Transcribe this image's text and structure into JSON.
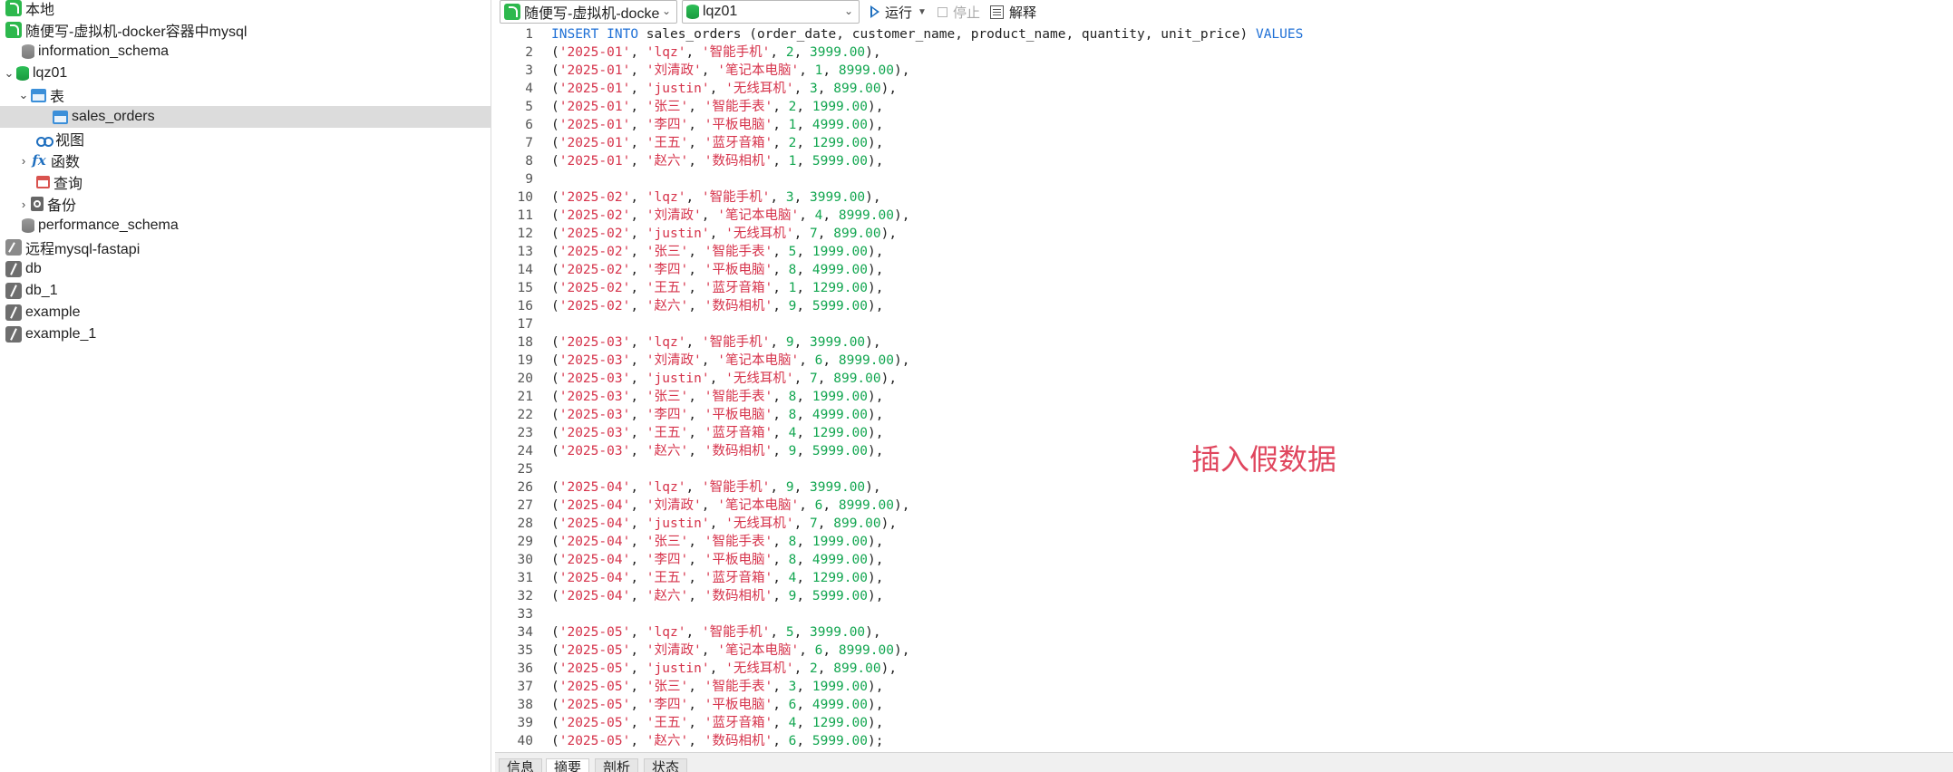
{
  "sidebar": {
    "items": [
      {
        "label": "本地",
        "icon": "connection-green-icon"
      },
      {
        "label": "随便写-虚拟机-docker容器中mysql",
        "icon": "connection-green-icon"
      },
      {
        "label": "information_schema",
        "icon": "database-icon"
      },
      {
        "label": "lqz01",
        "icon": "database-open-icon"
      },
      {
        "label": "表",
        "icon": "table-folder-icon"
      },
      {
        "label": "sales_orders",
        "icon": "table-icon"
      },
      {
        "label": "视图",
        "icon": "view-icon"
      },
      {
        "label": "函数",
        "icon": "function-icon"
      },
      {
        "label": "查询",
        "icon": "query-icon"
      },
      {
        "label": "备份",
        "icon": "backup-icon"
      },
      {
        "label": "performance_schema",
        "icon": "database-icon"
      },
      {
        "label": "远程mysql-fastapi",
        "icon": "connection-gray-icon"
      },
      {
        "label": "db",
        "icon": "connection-gray-icon"
      },
      {
        "label": "db_1",
        "icon": "connection-gray-icon"
      },
      {
        "label": "example",
        "icon": "connection-gray-icon"
      },
      {
        "label": "example_1",
        "icon": "connection-gray-icon"
      }
    ]
  },
  "toolbar": {
    "connection_select": "随便写-虚拟机-docke",
    "database_select": "lqz01",
    "run_label": "运行",
    "stop_label": "停止",
    "explain_label": "解释"
  },
  "editor": {
    "lines": [
      {
        "n": "1",
        "code": "INSERT INTO sales_orders (order_date, customer_name, product_name, quantity, unit_price) VALUES"
      },
      {
        "n": "2",
        "code": "('2025-01', 'lqz', '智能手机', 2, 3999.00),"
      },
      {
        "n": "3",
        "code": "('2025-01', '刘清政', '笔记本电脑', 1, 8999.00),"
      },
      {
        "n": "4",
        "code": "('2025-01', 'justin', '无线耳机', 3, 899.00),"
      },
      {
        "n": "5",
        "code": "('2025-01', '张三', '智能手表', 2, 1999.00),"
      },
      {
        "n": "6",
        "code": "('2025-01', '李四', '平板电脑', 1, 4999.00),"
      },
      {
        "n": "7",
        "code": "('2025-01', '王五', '蓝牙音箱', 2, 1299.00),"
      },
      {
        "n": "8",
        "code": "('2025-01', '赵六', '数码相机', 1, 5999.00),"
      },
      {
        "n": "9",
        "code": ""
      },
      {
        "n": "10",
        "code": "('2025-02', 'lqz', '智能手机', 3, 3999.00),"
      },
      {
        "n": "11",
        "code": "('2025-02', '刘清政', '笔记本电脑', 4, 8999.00),"
      },
      {
        "n": "12",
        "code": "('2025-02', 'justin', '无线耳机', 7, 899.00),"
      },
      {
        "n": "13",
        "code": "('2025-02', '张三', '智能手表', 5, 1999.00),"
      },
      {
        "n": "14",
        "code": "('2025-02', '李四', '平板电脑', 8, 4999.00),"
      },
      {
        "n": "15",
        "code": "('2025-02', '王五', '蓝牙音箱', 1, 1299.00),"
      },
      {
        "n": "16",
        "code": "('2025-02', '赵六', '数码相机', 9, 5999.00),"
      },
      {
        "n": "17",
        "code": ""
      },
      {
        "n": "18",
        "code": "('2025-03', 'lqz', '智能手机', 9, 3999.00),"
      },
      {
        "n": "19",
        "code": "('2025-03', '刘清政', '笔记本电脑', 6, 8999.00),"
      },
      {
        "n": "20",
        "code": "('2025-03', 'justin', '无线耳机', 7, 899.00),"
      },
      {
        "n": "21",
        "code": "('2025-03', '张三', '智能手表', 8, 1999.00),"
      },
      {
        "n": "22",
        "code": "('2025-03', '李四', '平板电脑', 8, 4999.00),"
      },
      {
        "n": "23",
        "code": "('2025-03', '王五', '蓝牙音箱', 4, 1299.00),"
      },
      {
        "n": "24",
        "code": "('2025-03', '赵六', '数码相机', 9, 5999.00),"
      },
      {
        "n": "25",
        "code": ""
      },
      {
        "n": "26",
        "code": "('2025-04', 'lqz', '智能手机', 9, 3999.00),"
      },
      {
        "n": "27",
        "code": "('2025-04', '刘清政', '笔记本电脑', 6, 8999.00),"
      },
      {
        "n": "28",
        "code": "('2025-04', 'justin', '无线耳机', 7, 899.00),"
      },
      {
        "n": "29",
        "code": "('2025-04', '张三', '智能手表', 8, 1999.00),"
      },
      {
        "n": "30",
        "code": "('2025-04', '李四', '平板电脑', 8, 4999.00),"
      },
      {
        "n": "31",
        "code": "('2025-04', '王五', '蓝牙音箱', 4, 1299.00),"
      },
      {
        "n": "32",
        "code": "('2025-04', '赵六', '数码相机', 9, 5999.00),"
      },
      {
        "n": "33",
        "code": ""
      },
      {
        "n": "34",
        "code": "('2025-05', 'lqz', '智能手机', 5, 3999.00),"
      },
      {
        "n": "35",
        "code": "('2025-05', '刘清政', '笔记本电脑', 6, 8999.00),"
      },
      {
        "n": "36",
        "code": "('2025-05', 'justin', '无线耳机', 2, 899.00),"
      },
      {
        "n": "37",
        "code": "('2025-05', '张三', '智能手表', 3, 1999.00),"
      },
      {
        "n": "38",
        "code": "('2025-05', '李四', '平板电脑', 6, 4999.00),"
      },
      {
        "n": "39",
        "code": "('2025-05', '王五', '蓝牙音箱', 4, 1299.00),"
      },
      {
        "n": "40",
        "code": "('2025-05', '赵六', '数码相机', 6, 5999.00);"
      }
    ]
  },
  "annotation": "插入假数据",
  "bottom_tabs": [
    {
      "label": "信息"
    },
    {
      "label": "摘要"
    },
    {
      "label": "剖析"
    },
    {
      "label": "状态"
    }
  ],
  "colors": {
    "keyword": "#1f70d6",
    "string": "#d6334b",
    "number": "#12a650",
    "annotation": "#e0465e",
    "selection": "#dcdcdc"
  }
}
